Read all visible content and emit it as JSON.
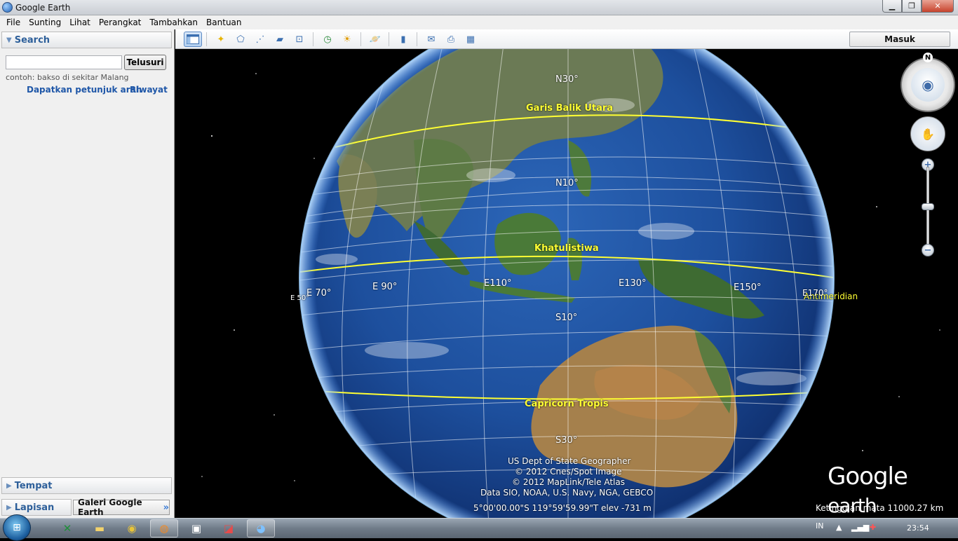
{
  "window": {
    "title": "Google Earth"
  },
  "menu": [
    "File",
    "Sunting",
    "Lihat",
    "Perangkat",
    "Tambahkan",
    "Bantuan"
  ],
  "sidebar": {
    "search_header": "Search",
    "search_value": "",
    "search_button": "Telusuri",
    "hint": "contoh: bakso di sekitar Malang",
    "directions_link": "Dapatkan petunjuk arah",
    "history_link": "Riwayat",
    "places_header": "Tempat",
    "layers_header": "Lapisan",
    "gallery_button": "Galeri Google Earth"
  },
  "toolbar": {
    "icons": [
      "sidebar-toggle-icon",
      "placemark-icon",
      "polygon-icon",
      "path-icon",
      "overlay-icon",
      "tour-icon",
      "historical-imagery-icon",
      "sunlight-icon",
      "planets-icon",
      "ruler-icon",
      "email-icon",
      "print-icon",
      "view-in-maps-icon"
    ],
    "signin_label": "Masuk"
  },
  "map": {
    "labels": {
      "tropic_cancer": "Garis Balik Utara",
      "equator": "Khatulistiwa",
      "tropic_capricorn": "Capricorn Tropis",
      "antimeridian": "Antimeridian",
      "n30": "N30°",
      "n10": "N10°",
      "s10": "S10°",
      "s30": "S30°",
      "e50": "E 50°",
      "e70": "E 70°",
      "e90": "E 90°",
      "e110": "E110°",
      "e130": "E130°",
      "e150": "E150°",
      "e170": "E170°"
    },
    "attribution": [
      "US Dept of State Geographer",
      "© 2012 Cnes/Spot Image",
      "© 2012 MapLink/Tele Atlas",
      "Data SIO, NOAA, U.S. Navy, NGA, GEBCO"
    ],
    "status": "5°00'00.00\"S 119°59'59.99\"T elev -731 m",
    "eye_altitude": "Ketinggian mata 11000.27 km",
    "logo_google": "Google",
    "logo_earth": "earth",
    "north_label": "N"
  },
  "taskbar": {
    "apps": [
      "excel-icon",
      "explorer-icon",
      "chrome-icon",
      "firefox-icon",
      "media-icon",
      "pdf-icon",
      "google-earth-icon"
    ],
    "lang": "IN",
    "time": "23:54"
  },
  "colors": {
    "accent": "#2d5f9a",
    "ocean": "#1b4f9c",
    "grid_yellow": "#ffff33"
  }
}
